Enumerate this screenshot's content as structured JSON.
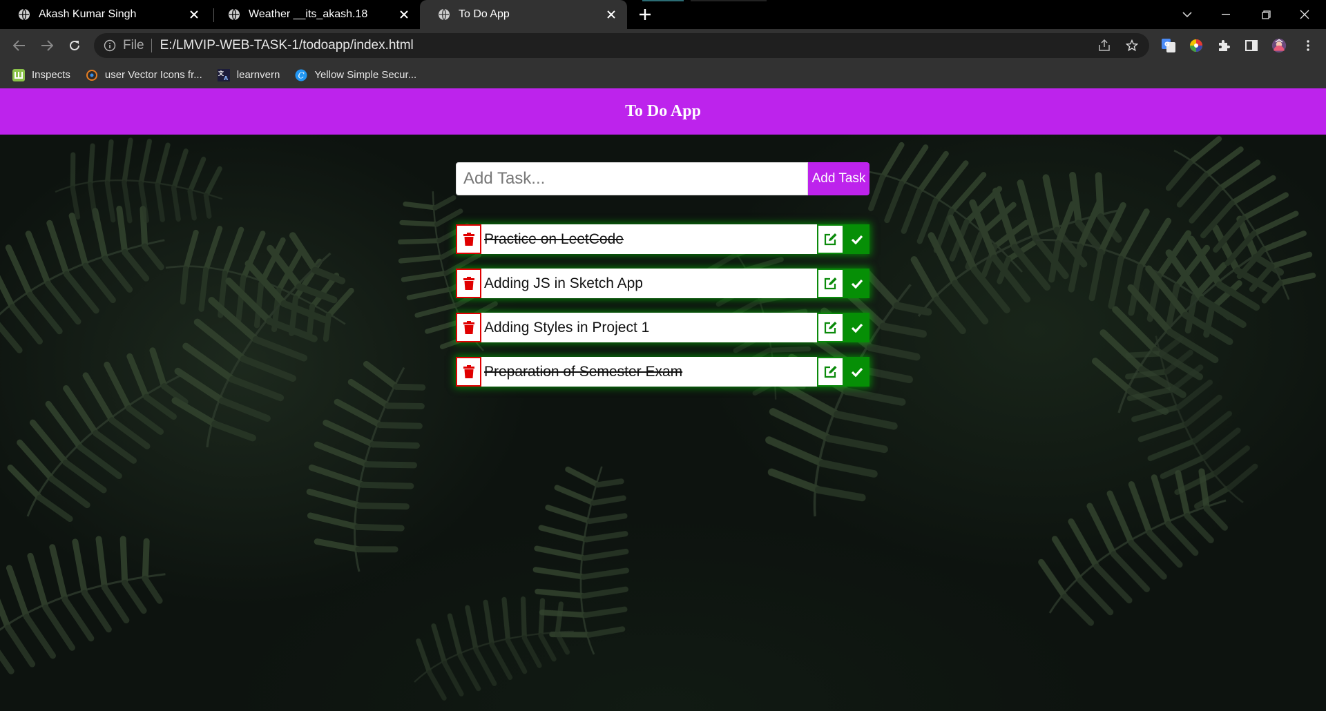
{
  "browser": {
    "tabs": [
      {
        "title": "Akash Kumar Singh",
        "active": false
      },
      {
        "title": "Weather __its_akash.18",
        "active": false
      },
      {
        "title": "To Do App",
        "active": true
      }
    ],
    "address": {
      "scheme_label": "File",
      "url": "E:/LMVIP-WEB-TASK-1/todoapp/index.html"
    },
    "bookmarks": [
      {
        "label": "Inspects",
        "icon": "inspects-icon"
      },
      {
        "label": "user Vector Icons fr...",
        "icon": "vector-icons-icon"
      },
      {
        "label": "learnvern",
        "icon": "learnvern-icon"
      },
      {
        "label": "Yellow Simple Secur...",
        "icon": "canva-icon"
      }
    ]
  },
  "app": {
    "title": "To Do App",
    "input_placeholder": "Add Task...",
    "add_button_label": "Add Task",
    "tasks": [
      {
        "text": "Practice on LeetCode",
        "completed": true
      },
      {
        "text": "Adding JS in Sketch App",
        "completed": false
      },
      {
        "text": "Adding Styles in Project 1",
        "completed": false
      },
      {
        "text": "Preparation of Semester Exam",
        "completed": true
      }
    ]
  },
  "colors": {
    "header": "#bd23ec",
    "delete": "#e00000",
    "edit_border": "#0a8a0a",
    "check": "#068f06",
    "task_glow": "#00d200"
  }
}
